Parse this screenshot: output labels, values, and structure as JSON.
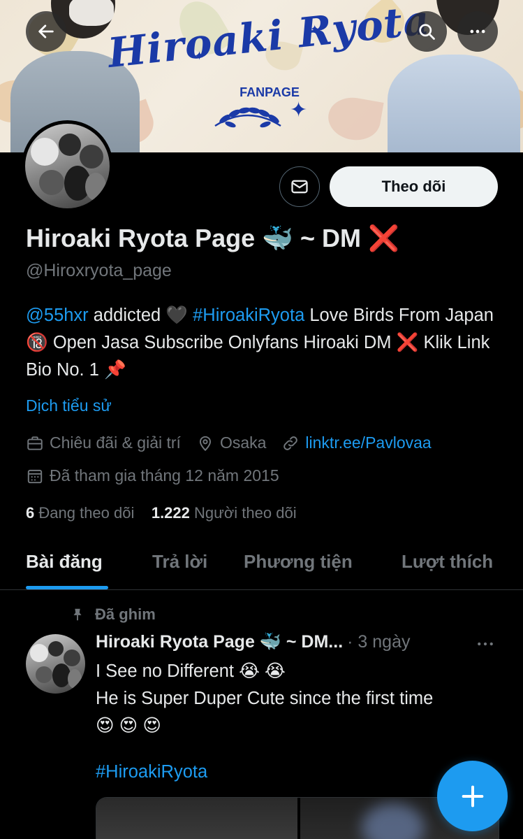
{
  "banner": {
    "title": "Hiroaki Ryota",
    "subtitle": "FANPAGE"
  },
  "top_bar": {
    "back_icon": "arrow-left-icon",
    "search_icon": "search-icon",
    "more_icon": "more-horizontal-icon"
  },
  "profile": {
    "display_name": "Hiroaki Ryota Page 🐳 ~ DM ❌",
    "handle": "@Hiroxryota_page",
    "follow_button": "Theo dõi",
    "message_icon": "mail-icon",
    "bio_mention": "@55hxr",
    "bio_part1": " addicted 🖤 ",
    "bio_hashtag": "#HiroakiRyota",
    "bio_part2": " Love Birds From Japan 🔞 Open Jasa Subscribe Onlyfans Hiroaki DM ❌ Klik Link Bio No. 1 📌",
    "translate_bio": "Dịch tiểu sử",
    "category": "Chiêu đãi & giải trí",
    "location": "Osaka",
    "website": "linktr.ee/Pavlovaa",
    "joined": "Đã tham gia tháng 12 năm 2015",
    "following_count": "6",
    "following_label": "Đang theo dõi",
    "followers_count": "1.222",
    "followers_label": "Người theo dõi"
  },
  "tabs": [
    {
      "label": "Bài đăng",
      "active": true
    },
    {
      "label": "Trả lời",
      "active": false
    },
    {
      "label": "Phương tiện",
      "active": false
    },
    {
      "label": "Lượt thích",
      "active": false
    }
  ],
  "pinned_post": {
    "pinned_label": "Đã ghim",
    "author": "Hiroaki Ryota Page 🐳 ~ DM...",
    "time": "· 3 ngày",
    "line1": "I See no Different 😭 😭",
    "line2": "He is Super Duper Cute since the first time",
    "line3": "😍 😍 😍",
    "hashtag": "#HiroakiRyota"
  },
  "fab": {
    "icon": "plus-icon"
  },
  "colors": {
    "background": "#000000",
    "accent": "#1d9bf0",
    "text_primary": "#e7e9ea",
    "text_secondary": "#71767b",
    "follow_button_bg": "#eff3f4"
  }
}
